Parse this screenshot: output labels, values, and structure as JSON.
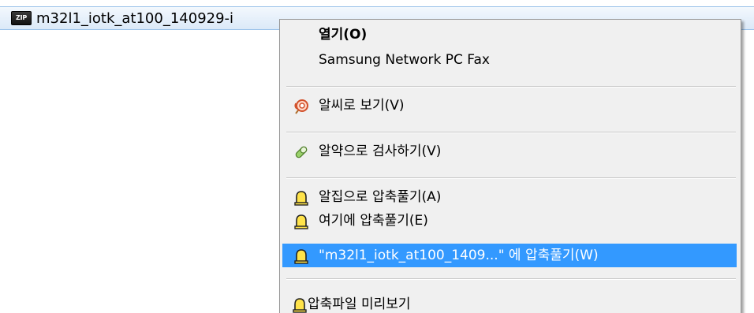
{
  "file": {
    "icon_text": "ZIP",
    "name": "m32l1_iotk_at100_140929-i"
  },
  "menu": {
    "items": [
      {
        "label": "열기(O)",
        "icon": "none",
        "bold": true
      },
      {
        "label": "Samsung Network PC Fax",
        "icon": "none"
      },
      {
        "label": "알씨로 보기(V)",
        "icon": "alsee-icon"
      },
      {
        "label": "알약으로 검사하기(V)",
        "icon": "alyac-pill-icon"
      },
      {
        "label": "알집으로 압축풀기(A)",
        "icon": "alzip-icon"
      },
      {
        "label": "여기에 압축풀기(E)",
        "icon": "alzip-icon"
      },
      {
        "label": "\"m32l1_iotk_at100_1409...\" 에 압축풀기(W)",
        "icon": "alzip-icon",
        "highlighted": true
      },
      {
        "label": "압축파일 미리보기",
        "icon": "alzip-icon"
      }
    ]
  },
  "colors": {
    "highlight": "#3399ff",
    "menu_background": "#f0f0f0"
  }
}
